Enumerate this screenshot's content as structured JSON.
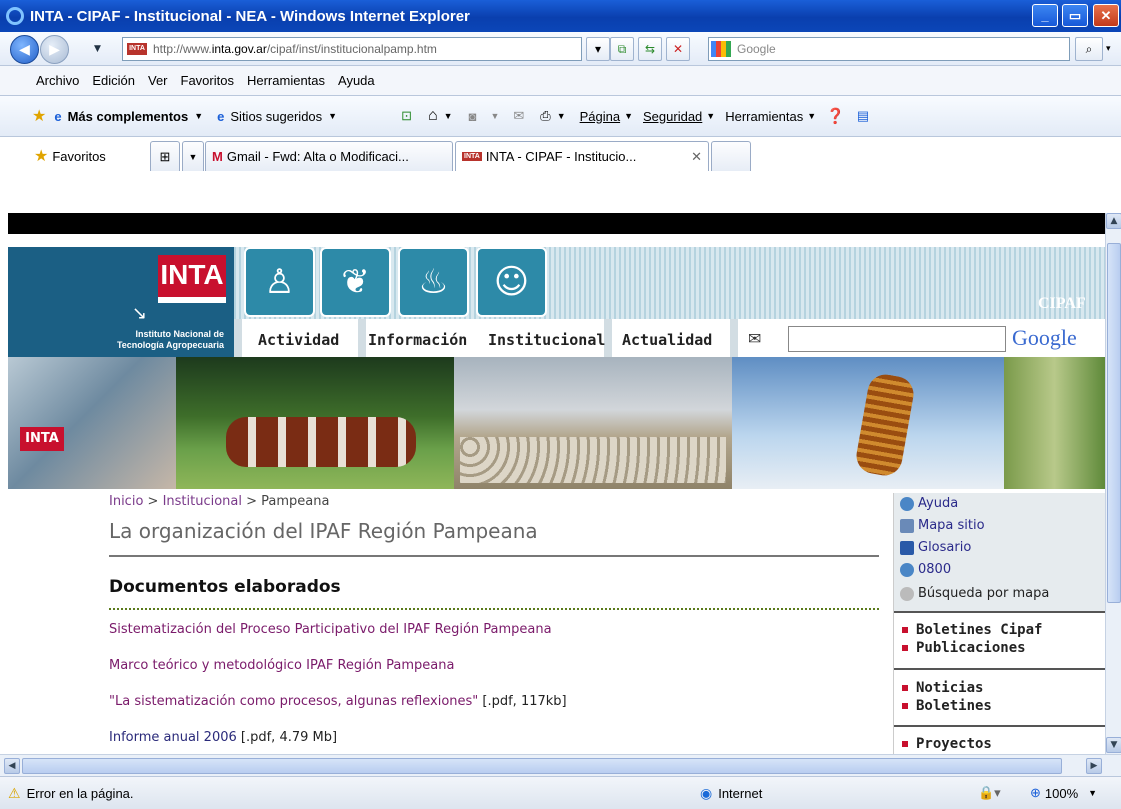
{
  "window": {
    "title": "INTA - CIPAF - Institucional - NEA - Windows Internet Explorer"
  },
  "address": {
    "prefix": "http://www.",
    "host": "inta.gov.ar",
    "path": "/cipaf/inst/institucionalpamp.htm"
  },
  "search": {
    "placeholder": "Google"
  },
  "menu": [
    "Archivo",
    "Edición",
    "Ver",
    "Favoritos",
    "Herramientas",
    "Ayuda"
  ],
  "commandbar": {
    "more_addons": "Más complementos",
    "suggested": "Sitios sugeridos",
    "page": "Página",
    "security": "Seguridad",
    "tools": "Herramientas"
  },
  "tabs": {
    "favorites": "Favoritos",
    "tab1": "Gmail - Fwd: Alta o Modificaci...",
    "tab2": "INTA - CIPAF - Institucio..."
  },
  "site": {
    "logo_text": "INTA",
    "org_name_1": "Instituto Nacional de",
    "org_name_2": "Tecnología Agropecuaria",
    "cipaf": "CIPAF",
    "nav": [
      "Actividad",
      "Información",
      "Institucional",
      "Actualidad"
    ],
    "google_label": "Google"
  },
  "breadcrumb": {
    "home": "Inicio",
    "sep1": " > ",
    "section": "Institucional",
    "sep2": " > ",
    "current": "Pampeana"
  },
  "page": {
    "title": "La organización del IPAF Región Pampeana",
    "docs_heading": "Documentos elaborados"
  },
  "documents": [
    {
      "text": "Sistematización del Proceso Participativo del IPAF Región Pampeana",
      "meta": ""
    },
    {
      "text": "Marco teórico y metodológico IPAF Región Pampeana",
      "meta": ""
    },
    {
      "text": "\"La sistematización como procesos, algunas reflexiones\"",
      "meta": " [.pdf, 117kb]"
    },
    {
      "text": "Informe anual 2006",
      "meta": " [.pdf, 4.79 Mb]"
    }
  ],
  "help": {
    "ayuda": "Ayuda",
    "mapa": "Mapa sitio",
    "glosario": "Glosario",
    "phone": "0800",
    "busqueda": "Búsqueda por mapa"
  },
  "right_links": {
    "boletines_cipaf": "Boletines Cipaf",
    "publicaciones": "Publicaciones",
    "noticias": "Noticias",
    "boletines": "Boletines",
    "proyectos": "Proyectos"
  },
  "status": {
    "error": "Error en la página.",
    "zone": "Internet",
    "zoom": "100%"
  }
}
